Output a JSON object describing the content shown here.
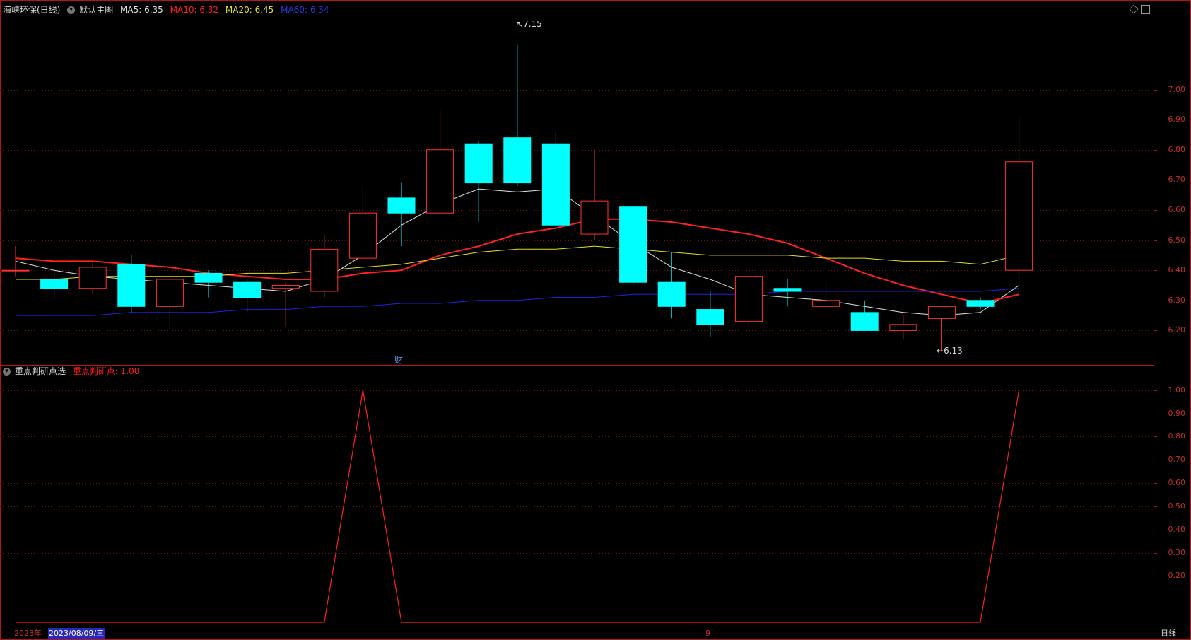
{
  "main_header": {
    "title": "海峡环保(日线)",
    "template": "默认主图",
    "ma5": "MA5: 6.35",
    "ma10": "MA10: 6.32",
    "ma20": "MA20: 6.45",
    "ma60": "MA60: 6.34"
  },
  "sub_header": {
    "title": "重点判研点选",
    "value": "重点判研点: 1.00"
  },
  "footer": {
    "year": "2023年",
    "date": "2023/08/09/三",
    "month_marker": "9",
    "period": "日线"
  },
  "annotations": {
    "max_label": "7.15",
    "min_label": "6.13",
    "event_marker": "财"
  },
  "colors": {
    "up": "#ff3232",
    "down": "#00ffff",
    "ma5": "#e0e0e0",
    "ma10": "#ff2020",
    "ma20": "#e0e020",
    "ma60": "#2020e0",
    "indicator": "#ff2020",
    "axis": "#b01818"
  },
  "chart_data": [
    {
      "type": "candlestick",
      "title": "海峡环保(日线)",
      "y_ticks": [
        6.2,
        6.3,
        6.4,
        6.5,
        6.6,
        6.7,
        6.8,
        6.9,
        7.0
      ],
      "y_tick_labels": [
        "6.20",
        "6.30",
        "6.40",
        "6.50",
        "6.60",
        "6.70",
        "6.80",
        "6.90",
        "7.00"
      ],
      "ylim": [
        6.1,
        7.25
      ],
      "grid": true,
      "candles": [
        {
          "o": 6.4,
          "h": 6.48,
          "l": 6.38,
          "c": 6.4
        },
        {
          "o": 6.37,
          "h": 6.4,
          "l": 6.31,
          "c": 6.34
        },
        {
          "o": 6.34,
          "h": 6.43,
          "l": 6.32,
          "c": 6.41
        },
        {
          "o": 6.42,
          "h": 6.45,
          "l": 6.26,
          "c": 6.28
        },
        {
          "o": 6.28,
          "h": 6.39,
          "l": 6.2,
          "c": 6.37
        },
        {
          "o": 6.39,
          "h": 6.4,
          "l": 6.31,
          "c": 6.36
        },
        {
          "o": 6.36,
          "h": 6.37,
          "l": 6.26,
          "c": 6.31
        },
        {
          "o": 6.34,
          "h": 6.36,
          "l": 6.21,
          "c": 6.35
        },
        {
          "o": 6.33,
          "h": 6.52,
          "l": 6.31,
          "c": 6.47
        },
        {
          "o": 6.44,
          "h": 6.68,
          "l": 6.44,
          "c": 6.59
        },
        {
          "o": 6.64,
          "h": 6.69,
          "l": 6.48,
          "c": 6.59
        },
        {
          "o": 6.59,
          "h": 6.93,
          "l": 6.59,
          "c": 6.8
        },
        {
          "o": 6.82,
          "h": 6.83,
          "l": 6.56,
          "c": 6.69
        },
        {
          "o": 6.84,
          "h": 7.15,
          "l": 6.68,
          "c": 6.69
        },
        {
          "o": 6.82,
          "h": 6.86,
          "l": 6.53,
          "c": 6.55
        },
        {
          "o": 6.52,
          "h": 6.8,
          "l": 6.5,
          "c": 6.63
        },
        {
          "o": 6.61,
          "h": 6.61,
          "l": 6.35,
          "c": 6.36
        },
        {
          "o": 6.36,
          "h": 6.46,
          "l": 6.24,
          "c": 6.28
        },
        {
          "o": 6.27,
          "h": 6.33,
          "l": 6.18,
          "c": 6.22
        },
        {
          "o": 6.23,
          "h": 6.4,
          "l": 6.21,
          "c": 6.38
        },
        {
          "o": 6.34,
          "h": 6.37,
          "l": 6.28,
          "c": 6.33
        },
        {
          "o": 6.28,
          "h": 6.36,
          "l": 6.28,
          "c": 6.3
        },
        {
          "o": 6.26,
          "h": 6.3,
          "l": 6.2,
          "c": 6.2
        },
        {
          "o": 6.2,
          "h": 6.25,
          "l": 6.17,
          "c": 6.22
        },
        {
          "o": 6.24,
          "h": 6.28,
          "l": 6.13,
          "c": 6.28
        },
        {
          "o": 6.3,
          "h": 6.31,
          "l": 6.27,
          "c": 6.28
        },
        {
          "o": 6.4,
          "h": 6.91,
          "l": 6.35,
          "c": 6.76
        }
      ],
      "series": [
        {
          "name": "MA5",
          "values": [
            6.43,
            6.4,
            6.38,
            6.37,
            6.36,
            6.35,
            6.34,
            6.33,
            6.37,
            6.45,
            6.55,
            6.62,
            6.67,
            6.66,
            6.67,
            6.58,
            6.49,
            6.41,
            6.37,
            6.32,
            6.31,
            6.3,
            6.28,
            6.26,
            6.25,
            6.26,
            6.35
          ]
        },
        {
          "name": "MA10",
          "values": [
            6.44,
            6.43,
            6.43,
            6.42,
            6.41,
            6.39,
            6.38,
            6.37,
            6.37,
            6.39,
            6.4,
            6.45,
            6.48,
            6.52,
            6.54,
            6.57,
            6.57,
            6.56,
            6.54,
            6.52,
            6.49,
            6.44,
            6.39,
            6.35,
            6.32,
            6.29,
            6.32
          ]
        },
        {
          "name": "MA20",
          "values": [
            6.37,
            6.37,
            6.38,
            6.38,
            6.38,
            6.38,
            6.39,
            6.39,
            6.4,
            6.41,
            6.42,
            6.44,
            6.46,
            6.47,
            6.47,
            6.48,
            6.47,
            6.46,
            6.45,
            6.45,
            6.45,
            6.44,
            6.44,
            6.43,
            6.43,
            6.42,
            6.45
          ]
        },
        {
          "name": "MA60",
          "values": [
            6.25,
            6.25,
            6.25,
            6.26,
            6.26,
            6.26,
            6.27,
            6.27,
            6.28,
            6.28,
            6.29,
            6.29,
            6.3,
            6.3,
            6.31,
            6.31,
            6.32,
            6.32,
            6.32,
            6.32,
            6.33,
            6.33,
            6.33,
            6.33,
            6.33,
            6.33,
            6.34
          ]
        }
      ]
    },
    {
      "type": "line",
      "title": "重点判研点选",
      "y_ticks": [
        0.2,
        0.3,
        0.4,
        0.5,
        0.6,
        0.7,
        0.8,
        0.9,
        1.0
      ],
      "y_tick_labels": [
        "0.20",
        "0.30",
        "0.40",
        "0.50",
        "0.60",
        "0.70",
        "0.80",
        "0.90",
        "1.00"
      ],
      "ylim": [
        0,
        1.06
      ],
      "grid": true,
      "series": [
        {
          "name": "重点判研点",
          "values": [
            0,
            0,
            0,
            0,
            0,
            0,
            0,
            0,
            0,
            1,
            0,
            0,
            0,
            0,
            0,
            0,
            0,
            0,
            0,
            0,
            0,
            0,
            0,
            0,
            0,
            0,
            1
          ]
        }
      ]
    }
  ]
}
